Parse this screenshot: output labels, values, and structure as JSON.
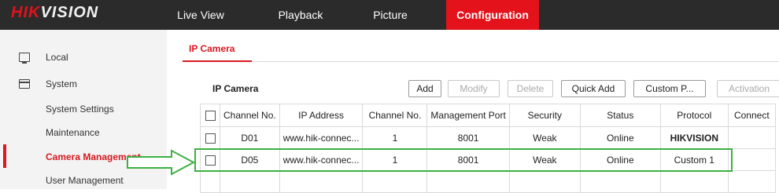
{
  "brand": {
    "red": "HIK",
    "white": "VISION"
  },
  "nav": {
    "live_view": "Live View",
    "playback": "Playback",
    "picture": "Picture",
    "configuration": "Configuration"
  },
  "sidebar": {
    "local": "Local",
    "system": "System",
    "system_settings": "System Settings",
    "maintenance": "Maintenance",
    "camera_management": "Camera Management",
    "user_management": "User Management"
  },
  "tab": "IP Camera",
  "grid": {
    "title": "IP Camera",
    "buttons": {
      "add": "Add",
      "modify": "Modify",
      "delete": "Delete",
      "quick_add": "Quick Add",
      "custom": "Custom P...",
      "activation": "Activation"
    },
    "headers": [
      "Channel No.",
      "IP Address",
      "Channel No.",
      "Management Port",
      "Security",
      "Status",
      "Protocol",
      "Connect"
    ],
    "rows": [
      [
        "D01",
        "www.hik-connec...",
        "1",
        "8001",
        "Weak",
        "Online",
        "HIKVISION",
        ""
      ],
      [
        "D05",
        "www.hik-connec...",
        "1",
        "8001",
        "Weak",
        "Online",
        "Custom 1",
        ""
      ]
    ]
  },
  "colors": {
    "accent": "#e3121b",
    "highlight": "#3cb043",
    "topbar": "#2b2b2b"
  },
  "icons": {
    "local": "monitor-icon",
    "system": "window-icon",
    "arrow": "right-arrow-icon"
  }
}
